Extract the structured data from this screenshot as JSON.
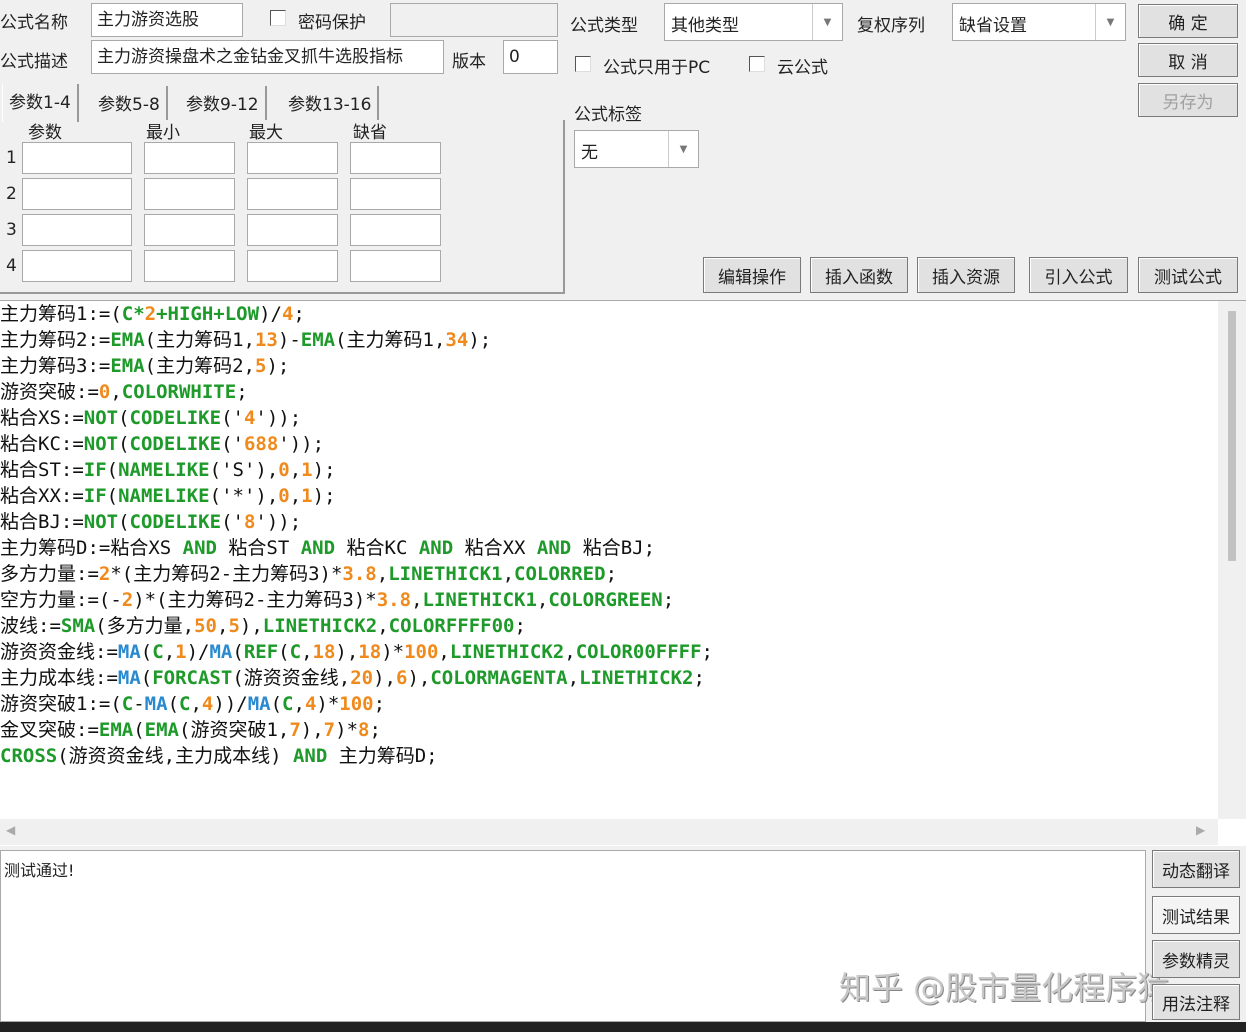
{
  "header": {
    "name_label": "公式名称",
    "name_value": "主力游资选股",
    "password_label": "密码保护",
    "desc_label": "公式描述",
    "desc_value": "主力游资操盘术之金钻金叉抓牛选股指标",
    "version_label": "版本",
    "version_value": "0",
    "type_label": "公式类型",
    "type_value": "其他类型",
    "rights_label": "复权序列",
    "rights_value": "缺省设置",
    "pc_only_label": "公式只用于PC",
    "cloud_label": "云公式",
    "tag_label": "公式标签",
    "tag_value": "无"
  },
  "buttons": {
    "ok": "确 定",
    "cancel": "取 消",
    "save_as": "另存为",
    "edit": "编辑操作",
    "insert_func": "插入函数",
    "insert_res": "插入资源",
    "import": "引入公式",
    "test": "测试公式"
  },
  "tabs": [
    "参数1-4",
    "参数5-8",
    "参数9-12",
    "参数13-16"
  ],
  "params": {
    "headers": [
      "参数",
      "最小",
      "最大",
      "缺省"
    ],
    "rows": [
      "1",
      "2",
      "3",
      "4"
    ]
  },
  "code": [
    [
      [
        "主力筹码1:=(",
        "t"
      ],
      [
        "C*",
        "f"
      ],
      [
        "2",
        "n"
      ],
      [
        "+HIGH+LOW",
        "f"
      ],
      [
        ")/",
        "t"
      ],
      [
        "4",
        "n"
      ],
      [
        ";",
        "t"
      ]
    ],
    [
      [
        "主力筹码2:=",
        "t"
      ],
      [
        "EMA",
        "f"
      ],
      [
        "(主力筹码1,",
        "t"
      ],
      [
        "13",
        "n"
      ],
      [
        ")-",
        "t"
      ],
      [
        "EMA",
        "f"
      ],
      [
        "(主力筹码1,",
        "t"
      ],
      [
        "34",
        "n"
      ],
      [
        ");",
        "t"
      ]
    ],
    [
      [
        "主力筹码3:=",
        "t"
      ],
      [
        "EMA",
        "f"
      ],
      [
        "(主力筹码2,",
        "t"
      ],
      [
        "5",
        "n"
      ],
      [
        ");",
        "t"
      ]
    ],
    [
      [
        "游资突破:=",
        "t"
      ],
      [
        "0",
        "n"
      ],
      [
        ",",
        "t"
      ],
      [
        "COLORWHITE",
        "f"
      ],
      [
        ";",
        "t"
      ]
    ],
    [
      [
        "粘合XS:=",
        "t"
      ],
      [
        "NOT",
        "f"
      ],
      [
        "(",
        "t"
      ],
      [
        "CODELIKE",
        "f"
      ],
      [
        "('",
        "t"
      ],
      [
        "4",
        "n"
      ],
      [
        "'));",
        "t"
      ]
    ],
    [
      [
        "粘合KC:=",
        "t"
      ],
      [
        "NOT",
        "f"
      ],
      [
        "(",
        "t"
      ],
      [
        "CODELIKE",
        "f"
      ],
      [
        "('",
        "t"
      ],
      [
        "688",
        "n"
      ],
      [
        "'));",
        "t"
      ]
    ],
    [
      [
        "粘合ST:=",
        "t"
      ],
      [
        "IF",
        "f"
      ],
      [
        "(",
        "t"
      ],
      [
        "NAMELIKE",
        "f"
      ],
      [
        "('S'),",
        "t"
      ],
      [
        "0",
        "n"
      ],
      [
        ",",
        "t"
      ],
      [
        "1",
        "n"
      ],
      [
        ");",
        "t"
      ]
    ],
    [
      [
        "粘合XX:=",
        "t"
      ],
      [
        "IF",
        "f"
      ],
      [
        "(",
        "t"
      ],
      [
        "NAMELIKE",
        "f"
      ],
      [
        "('*'),",
        "t"
      ],
      [
        "0",
        "n"
      ],
      [
        ",",
        "t"
      ],
      [
        "1",
        "n"
      ],
      [
        ");",
        "t"
      ]
    ],
    [
      [
        "粘合BJ:=",
        "t"
      ],
      [
        "NOT",
        "f"
      ],
      [
        "(",
        "t"
      ],
      [
        "CODELIKE",
        "f"
      ],
      [
        "('",
        "t"
      ],
      [
        "8",
        "n"
      ],
      [
        "'));",
        "t"
      ]
    ],
    [
      [
        "主力筹码D:=粘合XS ",
        "t"
      ],
      [
        "AND",
        "f"
      ],
      [
        " 粘合ST ",
        "t"
      ],
      [
        "AND",
        "f"
      ],
      [
        " 粘合KC ",
        "t"
      ],
      [
        "AND",
        "f"
      ],
      [
        " 粘合XX ",
        "t"
      ],
      [
        "AND",
        "f"
      ],
      [
        " 粘合BJ;",
        "t"
      ]
    ],
    [
      [
        "多方力量:=",
        "t"
      ],
      [
        "2",
        "n"
      ],
      [
        "*(主力筹码2-主力筹码3)*",
        "t"
      ],
      [
        "3.8",
        "n"
      ],
      [
        ",",
        "t"
      ],
      [
        "LINETHICK1",
        "f"
      ],
      [
        ",",
        "t"
      ],
      [
        "COLORRED",
        "f"
      ],
      [
        ";",
        "t"
      ]
    ],
    [
      [
        "空方力量:=(-",
        "t"
      ],
      [
        "2",
        "n"
      ],
      [
        ")*(主力筹码2-主力筹码3)*",
        "t"
      ],
      [
        "3.8",
        "n"
      ],
      [
        ",",
        "t"
      ],
      [
        "LINETHICK1",
        "f"
      ],
      [
        ",",
        "t"
      ],
      [
        "COLORGREEN",
        "f"
      ],
      [
        ";",
        "t"
      ]
    ],
    [
      [
        "波线:=",
        "t"
      ],
      [
        "SMA",
        "f"
      ],
      [
        "(多方力量,",
        "t"
      ],
      [
        "50",
        "n"
      ],
      [
        ",",
        "t"
      ],
      [
        "5",
        "n"
      ],
      [
        "),",
        "t"
      ],
      [
        "LINETHICK2",
        "f"
      ],
      [
        ",",
        "t"
      ],
      [
        "COLORFFFF00",
        "f"
      ],
      [
        ";",
        "t"
      ]
    ],
    [
      [
        "游资资金线:=",
        "t"
      ],
      [
        "MA",
        "m"
      ],
      [
        "(",
        "t"
      ],
      [
        "C",
        "f"
      ],
      [
        ",",
        "t"
      ],
      [
        "1",
        "n"
      ],
      [
        ")/",
        "t"
      ],
      [
        "MA",
        "m"
      ],
      [
        "(",
        "t"
      ],
      [
        "REF",
        "f"
      ],
      [
        "(",
        "t"
      ],
      [
        "C",
        "f"
      ],
      [
        ",",
        "t"
      ],
      [
        "18",
        "n"
      ],
      [
        "),",
        "t"
      ],
      [
        "18",
        "n"
      ],
      [
        ")*",
        "t"
      ],
      [
        "100",
        "n"
      ],
      [
        ",",
        "t"
      ],
      [
        "LINETHICK2",
        "f"
      ],
      [
        ",",
        "t"
      ],
      [
        "COLOR00FFFF",
        "f"
      ],
      [
        ";",
        "t"
      ]
    ],
    [
      [
        "主力成本线:=",
        "t"
      ],
      [
        "MA",
        "m"
      ],
      [
        "(",
        "t"
      ],
      [
        "FORCAST",
        "f"
      ],
      [
        "(游资资金线,",
        "t"
      ],
      [
        "20",
        "n"
      ],
      [
        "),",
        "t"
      ],
      [
        "6",
        "n"
      ],
      [
        "),",
        "t"
      ],
      [
        "COLORMAGENTA",
        "f"
      ],
      [
        ",",
        "t"
      ],
      [
        "LINETHICK2",
        "f"
      ],
      [
        ";",
        "t"
      ]
    ],
    [
      [
        "游资突破1:=(",
        "t"
      ],
      [
        "C",
        "f"
      ],
      [
        "-",
        "t"
      ],
      [
        "MA",
        "m"
      ],
      [
        "(",
        "t"
      ],
      [
        "C",
        "f"
      ],
      [
        ",",
        "t"
      ],
      [
        "4",
        "n"
      ],
      [
        "))/",
        "t"
      ],
      [
        "MA",
        "m"
      ],
      [
        "(",
        "t"
      ],
      [
        "C",
        "f"
      ],
      [
        ",",
        "t"
      ],
      [
        "4",
        "n"
      ],
      [
        ")*",
        "t"
      ],
      [
        "100",
        "n"
      ],
      [
        ";",
        "t"
      ]
    ],
    [
      [
        "金叉突破:=",
        "t"
      ],
      [
        "EMA",
        "f"
      ],
      [
        "(",
        "t"
      ],
      [
        "EMA",
        "f"
      ],
      [
        "(游资突破1,",
        "t"
      ],
      [
        "7",
        "n"
      ],
      [
        "),",
        "t"
      ],
      [
        "7",
        "n"
      ],
      [
        ")*",
        "t"
      ],
      [
        "8",
        "n"
      ],
      [
        ";",
        "t"
      ]
    ],
    [
      [
        "CROSS",
        "f"
      ],
      [
        "(游资资金线,主力成本线) ",
        "t"
      ],
      [
        "AND",
        "f"
      ],
      [
        " 主力筹码D;",
        "t"
      ]
    ]
  ],
  "output": {
    "text": "测试通过!"
  },
  "side_buttons": [
    "动态翻译",
    "测试结果",
    "参数精灵",
    "用法注释"
  ],
  "watermark": "知乎 @股市量化程序猿"
}
